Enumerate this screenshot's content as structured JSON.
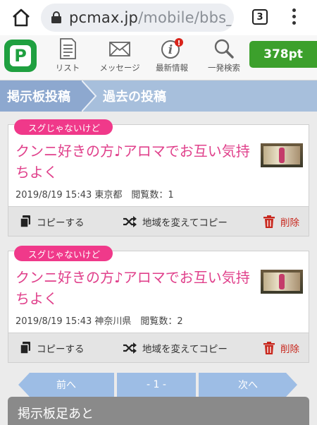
{
  "browser": {
    "url_host": "pcmax.jp",
    "url_path": "/mobile/bbs_w",
    "tab_count": "3"
  },
  "app_nav": {
    "logo_letter": "P",
    "items": [
      {
        "label": "リスト",
        "icon": "list-icon"
      },
      {
        "label": "メッセージ",
        "icon": "envelope-icon"
      },
      {
        "label": "最新情報",
        "icon": "info-icon",
        "badge": "!"
      },
      {
        "label": "一発検索",
        "icon": "search-icon"
      }
    ],
    "points": "378pt"
  },
  "breadcrumb": {
    "parent": "掲示板投稿",
    "current": "過去の投稿"
  },
  "posts": [
    {
      "tag": "スグじゃないけど",
      "title": "クンニ好きの方♪アロマでお互い気持ちよく",
      "meta": "2019/8/19 15:43 東京都　閲覧数：1",
      "copy_label": "コピーする",
      "region_copy_label": "地域を変えてコピー",
      "delete_label": "削除"
    },
    {
      "tag": "スグじゃないけど",
      "title": "クンニ好きの方♪アロマでお互い気持ちよく",
      "meta": "2019/8/19 15:43 神奈川県　閲覧数：2",
      "copy_label": "コピーする",
      "region_copy_label": "地域を変えてコピー",
      "delete_label": "削除"
    }
  ],
  "pager": {
    "prev": "前へ",
    "current": "- 1 -",
    "next": "次へ"
  },
  "footer_panel": {
    "title": "掲示板足あと"
  },
  "colors": {
    "accent_pink": "#e0408b",
    "tag_pink": "#f0398a",
    "points_green": "#3ca02c",
    "breadcrumb_blue": "#8da8cf",
    "delete_red": "#c8281e"
  }
}
